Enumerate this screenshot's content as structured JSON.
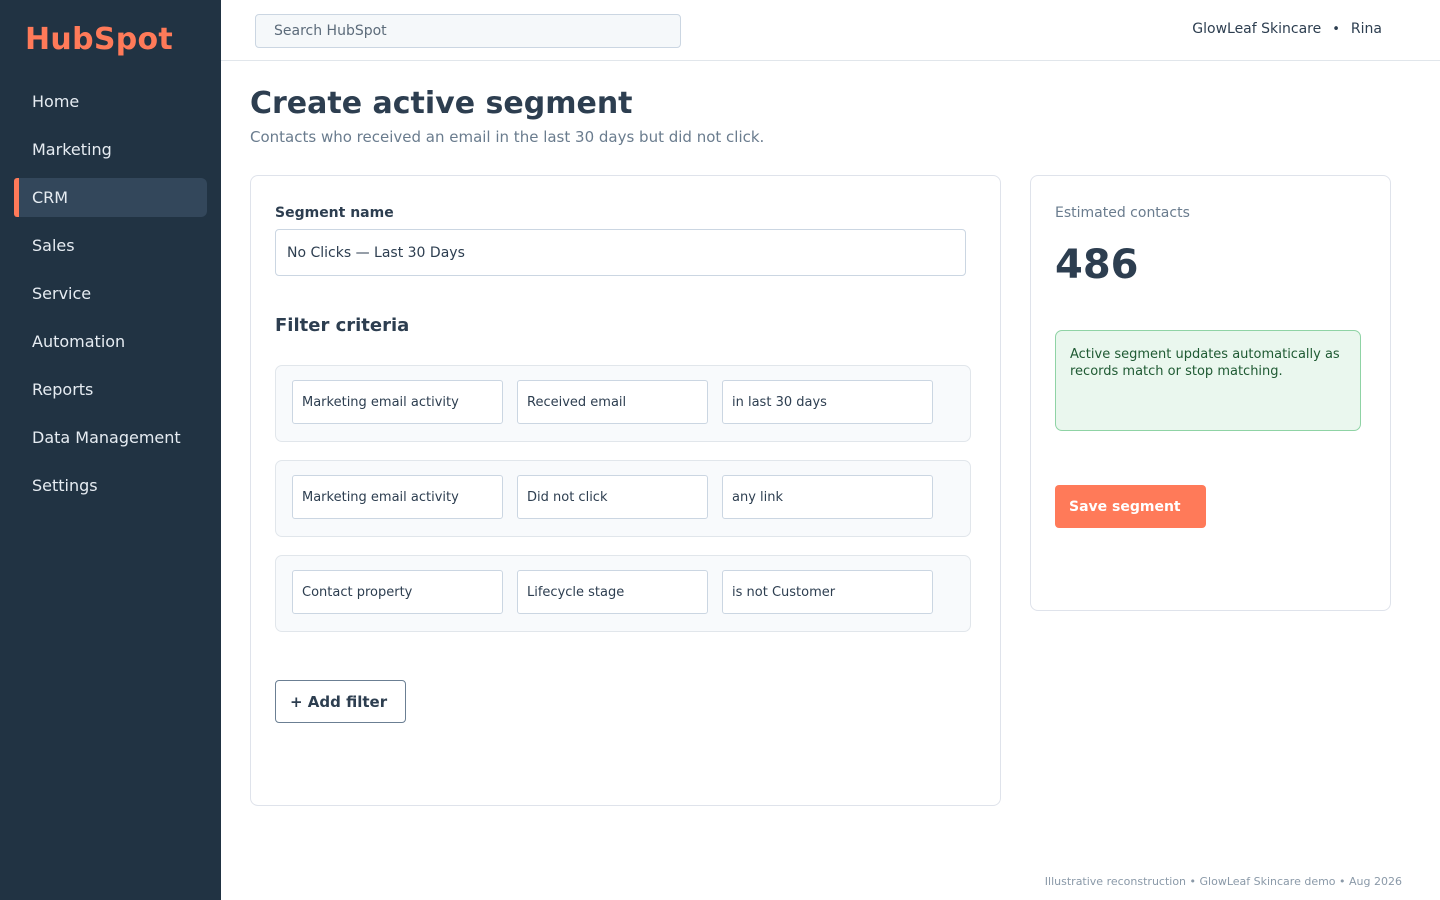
{
  "app": {
    "logo": "HubSpot"
  },
  "sidebar": {
    "items": [
      {
        "label": "Home"
      },
      {
        "label": "Marketing"
      },
      {
        "label": "CRM",
        "active": true
      },
      {
        "label": "Sales"
      },
      {
        "label": "Service"
      },
      {
        "label": "Automation"
      },
      {
        "label": "Reports"
      },
      {
        "label": "Data Management"
      },
      {
        "label": "Settings"
      }
    ]
  },
  "topbar": {
    "search_placeholder": "Search HubSpot",
    "account_name": "GlowLeaf Skincare",
    "separator": "•",
    "user_name": "Rina"
  },
  "page": {
    "title": "Create active segment",
    "subtitle": "Contacts who received an email in the last 30 days but did not click."
  },
  "form": {
    "name_label": "Segment name",
    "name_value": "No Clicks — Last 30 Days",
    "filters_title": "Filter criteria",
    "filters": [
      {
        "source": "Marketing email activity",
        "property": "Received email",
        "condition": "in last 30 days"
      },
      {
        "source": "Marketing email activity",
        "property": "Did not click",
        "condition": "any link"
      },
      {
        "source": "Contact property",
        "property": "Lifecycle stage",
        "condition": "is not Customer"
      }
    ],
    "add_filter_label": "+ Add filter"
  },
  "summary": {
    "estimate_label": "Estimated contacts",
    "estimate_value": "486",
    "info_text": "Active segment updates automatically as records match or stop matching.",
    "save_label": "Save segment"
  },
  "footer": {
    "text": "Illustrative reconstruction • GlowLeaf Skincare demo • Aug 2026"
  },
  "colors": {
    "brand": "#ff7a59",
    "sidebar_bg": "#213343",
    "sidebar_active": "#33475b",
    "info_bg": "#eaf7ee",
    "info_border": "#8fd3a5"
  }
}
